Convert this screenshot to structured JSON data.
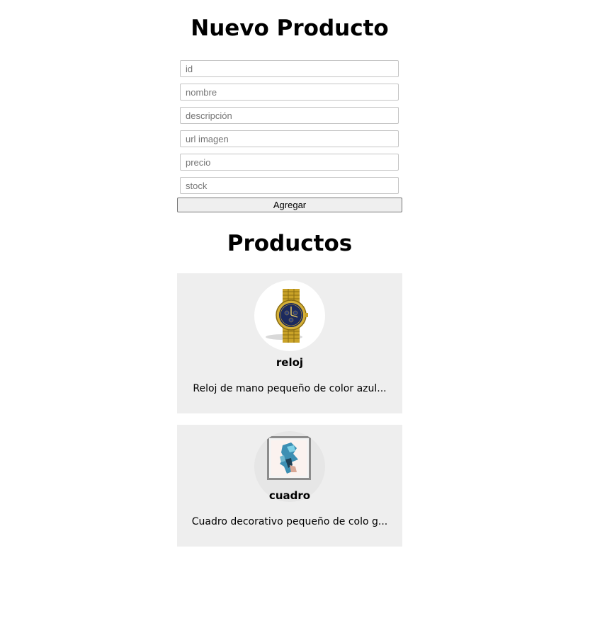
{
  "form": {
    "title": "Nuevo Producto",
    "fields": [
      {
        "name": "id",
        "placeholder": "id",
        "value": ""
      },
      {
        "name": "nombre",
        "placeholder": "nombre",
        "value": ""
      },
      {
        "name": "descripcion",
        "placeholder": "descripción",
        "value": ""
      },
      {
        "name": "url_imagen",
        "placeholder": "url imagen",
        "value": ""
      },
      {
        "name": "precio",
        "placeholder": "precio",
        "value": ""
      },
      {
        "name": "stock",
        "placeholder": "stock",
        "value": ""
      }
    ],
    "submit_label": "Agregar"
  },
  "products": {
    "title": "Productos",
    "items": [
      {
        "name": "reloj",
        "description": "Reloj de mano pequeño de color azul...",
        "image": "watch-image"
      },
      {
        "name": "cuadro",
        "description": "Cuadro decorativo pequeño de colo g...",
        "image": "painting-image"
      }
    ]
  },
  "colors": {
    "card_background": "#eeeeee",
    "button_background": "#efefef",
    "input_border": "#c4c4c4"
  }
}
